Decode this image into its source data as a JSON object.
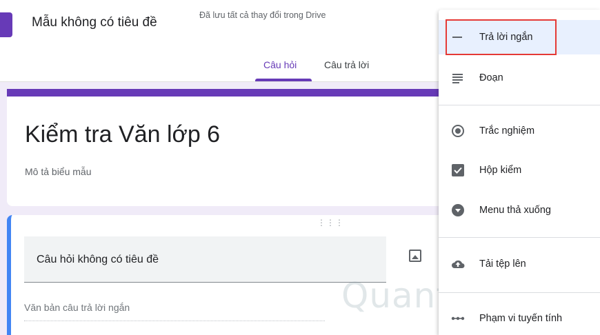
{
  "header": {
    "form_title": "Mẫu không có tiêu đề",
    "save_status": "Đã lưu tất cả thay đổi trong Drive",
    "tabs": [
      {
        "label": "Câu hỏi",
        "active": true
      },
      {
        "label": "Câu trả lời",
        "active": false
      }
    ]
  },
  "form": {
    "title": "Kiểm tra Văn lớp 6",
    "description": "Mô tả biểu mẫu"
  },
  "question": {
    "title": "Câu hỏi không có tiêu đề",
    "answer_placeholder": "Văn bản câu trả lời ngắn"
  },
  "menu": {
    "items": [
      {
        "label": "Trả lời ngắn",
        "icon": "short-answer-icon",
        "selected": true
      },
      {
        "label": "Đoạn",
        "icon": "paragraph-icon"
      },
      {
        "label": "Trắc nghiệm",
        "icon": "radio-button-icon"
      },
      {
        "label": "Hộp kiểm",
        "icon": "checkbox-icon"
      },
      {
        "label": "Menu thả xuống",
        "icon": "dropdown-arrow-icon"
      },
      {
        "label": "Tải tệp lên",
        "icon": "cloud-upload-icon"
      },
      {
        "label": "Phạm vi tuyến tính",
        "icon": "linear-scale-icon"
      }
    ]
  },
  "watermark": "Quantrimang",
  "colors": {
    "accent": "#673ab7",
    "background": "#f0ebf8",
    "highlight": "#e53935",
    "selected_bg": "#e8f0fe",
    "question_accent": "#4285f4"
  }
}
